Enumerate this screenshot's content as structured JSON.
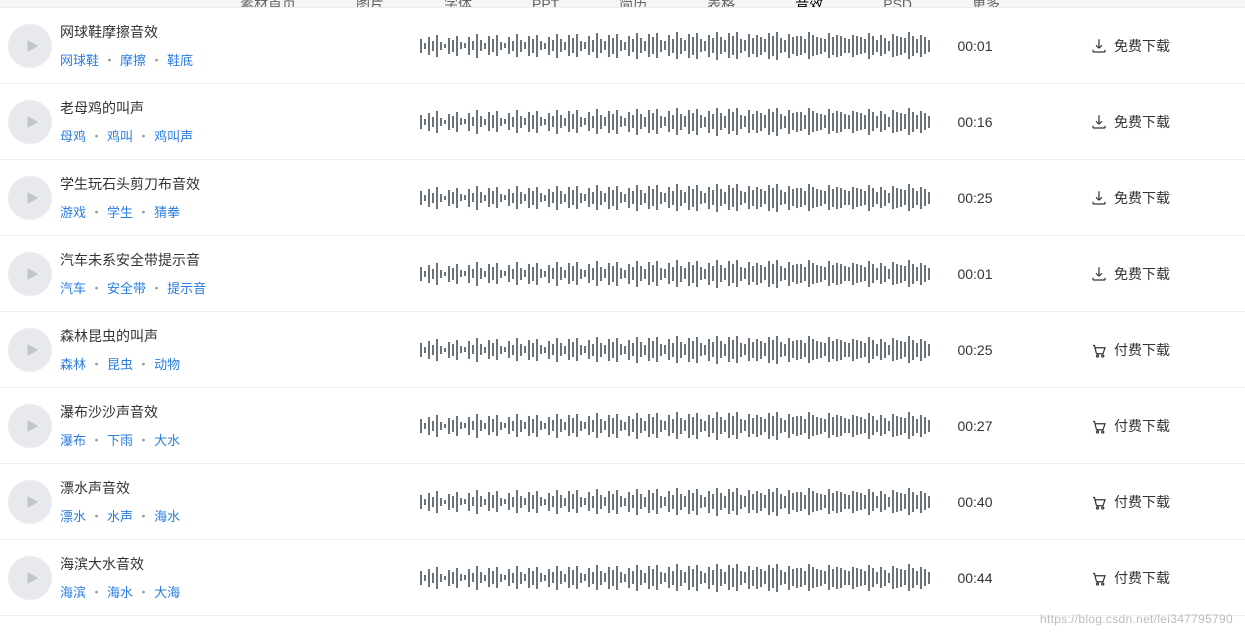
{
  "nav": {
    "items": [
      "素材首页",
      "图片",
      "字体",
      "PPT",
      "简历",
      "表格",
      "音效",
      "PSD",
      "更多"
    ],
    "active_index": 6
  },
  "download": {
    "free": "免费下载",
    "paid": "付费下载"
  },
  "watermark": "https://blog.csdn.net/lei347795790",
  "items": [
    {
      "title": "网球鞋摩擦音效",
      "tags": [
        "网球鞋",
        "摩擦",
        "鞋底"
      ],
      "duration": "00:01",
      "paid": false
    },
    {
      "title": "老母鸡的叫声",
      "tags": [
        "母鸡",
        "鸡叫",
        "鸡叫声"
      ],
      "duration": "00:16",
      "paid": false
    },
    {
      "title": "学生玩石头剪刀布音效",
      "tags": [
        "游戏",
        "学生",
        "猜拳"
      ],
      "duration": "00:25",
      "paid": false
    },
    {
      "title": "汽车未系安全带提示音",
      "tags": [
        "汽车",
        "安全带",
        "提示音"
      ],
      "duration": "00:01",
      "paid": false
    },
    {
      "title": "森林昆虫的叫声",
      "tags": [
        "森林",
        "昆虫",
        "动物"
      ],
      "duration": "00:25",
      "paid": true
    },
    {
      "title": "瀑布沙沙声音效",
      "tags": [
        "瀑布",
        "下雨",
        "大水"
      ],
      "duration": "00:27",
      "paid": true
    },
    {
      "title": "漂水声音效",
      "tags": [
        "漂水",
        "水声",
        "海水"
      ],
      "duration": "00:40",
      "paid": true
    },
    {
      "title": "海滨大水音效",
      "tags": [
        "海滨",
        "海水",
        "大海"
      ],
      "duration": "00:44",
      "paid": true
    }
  ],
  "wave_bars": [
    14,
    6,
    18,
    10,
    22,
    8,
    4,
    16,
    12,
    20,
    7,
    5,
    18,
    9,
    24,
    11,
    6,
    19,
    13,
    21,
    8,
    5,
    17,
    10,
    23,
    12,
    7,
    20,
    14,
    22,
    9,
    6,
    18,
    11,
    24,
    13,
    8,
    21,
    15,
    23,
    10,
    7,
    19,
    12,
    25,
    14,
    9,
    22,
    16,
    24,
    11,
    8,
    20,
    13,
    26,
    15,
    10,
    23,
    17,
    25,
    12,
    9,
    21,
    14,
    27,
    16,
    11,
    24,
    18,
    26,
    13,
    10,
    22,
    15,
    28,
    17,
    12,
    25,
    19,
    27,
    14,
    11,
    23,
    16,
    22,
    18,
    13,
    26,
    20,
    28,
    15,
    12,
    24,
    17,
    20,
    19,
    14,
    27,
    21,
    18,
    16,
    13,
    25,
    18,
    22,
    20,
    15,
    14,
    22,
    19,
    17,
    14,
    26,
    19,
    12,
    21,
    16,
    10,
    23,
    20,
    18,
    15,
    27,
    20,
    14,
    22,
    17,
    12
  ]
}
